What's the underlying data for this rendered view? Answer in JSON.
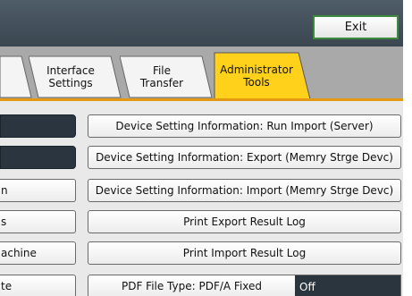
{
  "header": {
    "exit_label": "Exit"
  },
  "tabs": {
    "interface_settings": [
      "Interface",
      "Settings"
    ],
    "file_transfer": [
      "File",
      "Transfer"
    ],
    "administrator_tools": [
      "Administrator",
      "Tools"
    ]
  },
  "left_items": [
    "",
    "",
    "n",
    "s",
    "achine",
    "te"
  ],
  "settings": {
    "run_import_label": "Device Setting Information: Run Import (Server)",
    "export_memory_label": "Device Setting Information: Export (Memry Strge Devc)",
    "import_memory_label": "Device Setting Information: Import (Memry Strge Devc)",
    "print_export_log_label": "Print Export Result Log",
    "print_import_log_label": "Print Import Result Log",
    "pdf_file_type_label": "PDF File Type: PDF/A Fixed",
    "pdf_file_type_value": "Off"
  },
  "colors": {
    "active_tab": "#ffd11a",
    "tab_underline": "#e39a12",
    "header_bar": "#47535d",
    "exit_border": "#3c8a3c",
    "value_bg": "#2b353e"
  }
}
